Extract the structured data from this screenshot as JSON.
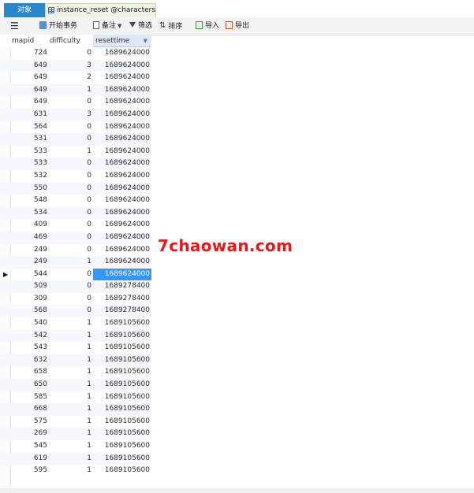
{
  "tabs": [
    {
      "label": "对象"
    },
    {
      "label": "instance_reset @characters ..."
    }
  ],
  "toolbar": {
    "menu_icon": "menu-icon",
    "begin_label": "开始事务",
    "note_label": "备注",
    "filter_label": "筛选",
    "sort_label": "排序",
    "import_label": "导入",
    "export_label": "导出"
  },
  "grid": {
    "columns": [
      "mapid",
      "difficulty",
      "resettime"
    ],
    "sorted_column": "resettime",
    "selected_row_index": 18,
    "rows": [
      [
        "724",
        "0",
        "1689624000"
      ],
      [
        "649",
        "3",
        "1689624000"
      ],
      [
        "649",
        "2",
        "1689624000"
      ],
      [
        "649",
        "1",
        "1689624000"
      ],
      [
        "649",
        "0",
        "1689624000"
      ],
      [
        "631",
        "3",
        "1689624000"
      ],
      [
        "564",
        "0",
        "1689624000"
      ],
      [
        "531",
        "0",
        "1689624000"
      ],
      [
        "533",
        "1",
        "1689624000"
      ],
      [
        "533",
        "0",
        "1689624000"
      ],
      [
        "532",
        "0",
        "1689624000"
      ],
      [
        "550",
        "0",
        "1689624000"
      ],
      [
        "548",
        "0",
        "1689624000"
      ],
      [
        "534",
        "0",
        "1689624000"
      ],
      [
        "409",
        "0",
        "1689624000"
      ],
      [
        "469",
        "0",
        "1689624000"
      ],
      [
        "249",
        "0",
        "1689624000"
      ],
      [
        "249",
        "1",
        "1689624000"
      ],
      [
        "544",
        "0",
        "1689624000"
      ],
      [
        "509",
        "0",
        "1689278400"
      ],
      [
        "309",
        "0",
        "1689278400"
      ],
      [
        "568",
        "0",
        "1689278400"
      ],
      [
        "540",
        "1",
        "1689105600"
      ],
      [
        "542",
        "1",
        "1689105600"
      ],
      [
        "543",
        "1",
        "1689105600"
      ],
      [
        "632",
        "1",
        "1689105600"
      ],
      [
        "658",
        "1",
        "1689105600"
      ],
      [
        "650",
        "1",
        "1689105600"
      ],
      [
        "585",
        "1",
        "1689105600"
      ],
      [
        "668",
        "1",
        "1689105600"
      ],
      [
        "575",
        "1",
        "1689105600"
      ],
      [
        "269",
        "1",
        "1689105600"
      ],
      [
        "545",
        "1",
        "1689105600"
      ],
      [
        "619",
        "1",
        "1689105600"
      ],
      [
        "595",
        "1",
        "1689105600"
      ]
    ]
  },
  "watermark": "7chaowan.com",
  "colors": {
    "tab_active": "#2f86c6",
    "selection": "#3399ff",
    "watermark": "#e01b1b"
  }
}
